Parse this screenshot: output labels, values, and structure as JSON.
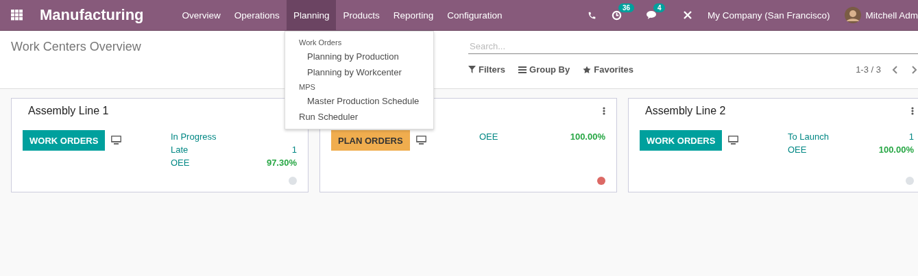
{
  "navbar": {
    "app_title": "Manufacturing",
    "menu": [
      {
        "label": "Overview",
        "selected": false
      },
      {
        "label": "Operations",
        "selected": false
      },
      {
        "label": "Planning",
        "selected": true
      },
      {
        "label": "Products",
        "selected": false
      },
      {
        "label": "Reporting",
        "selected": false
      },
      {
        "label": "Configuration",
        "selected": false
      }
    ],
    "activity_count": "36",
    "message_count": "4",
    "company": "My Company (San Francisco)",
    "user": "Mitchell Adm"
  },
  "dropdown": [
    {
      "kind": "header",
      "label": "Work Orders"
    },
    {
      "kind": "item",
      "label": "Planning by Production"
    },
    {
      "kind": "item",
      "label": "Planning by Workcenter"
    },
    {
      "kind": "header",
      "label": "MPS"
    },
    {
      "kind": "item",
      "label": "Master Production Schedule"
    },
    {
      "kind": "top",
      "label": "Run Scheduler"
    }
  ],
  "breadcrumb": "Work Centers Overview",
  "search": {
    "placeholder": "Search..."
  },
  "search_options": [
    "Filters",
    "Group By",
    "Favorites"
  ],
  "pager": "1-3 / 3",
  "cards": [
    {
      "title": "Assembly Line 1",
      "button": {
        "kind": "work",
        "label": "WORK ORDERS"
      },
      "stats": [
        {
          "label": "In Progress"
        },
        {
          "label": "Late",
          "value": "1"
        },
        {
          "kind": "oee",
          "label": "OEE",
          "value": "97.30%"
        }
      ],
      "color": "#dee2e6"
    },
    {
      "menu": true,
      "button": {
        "kind": "plan",
        "label": "PLAN ORDERS"
      },
      "stats": [
        {
          "kind": "oee",
          "label": "OEE",
          "value": "100.00%"
        }
      ],
      "color": "#dc6965"
    },
    {
      "title": "Assembly Line 2",
      "menu": true,
      "button": {
        "kind": "work",
        "label": "WORK ORDERS"
      },
      "stats": [
        {
          "label": "To Launch",
          "value": "1"
        },
        {
          "kind": "oee",
          "label": "OEE",
          "value": "100.00%"
        }
      ],
      "color": "#dee2e6"
    }
  ]
}
